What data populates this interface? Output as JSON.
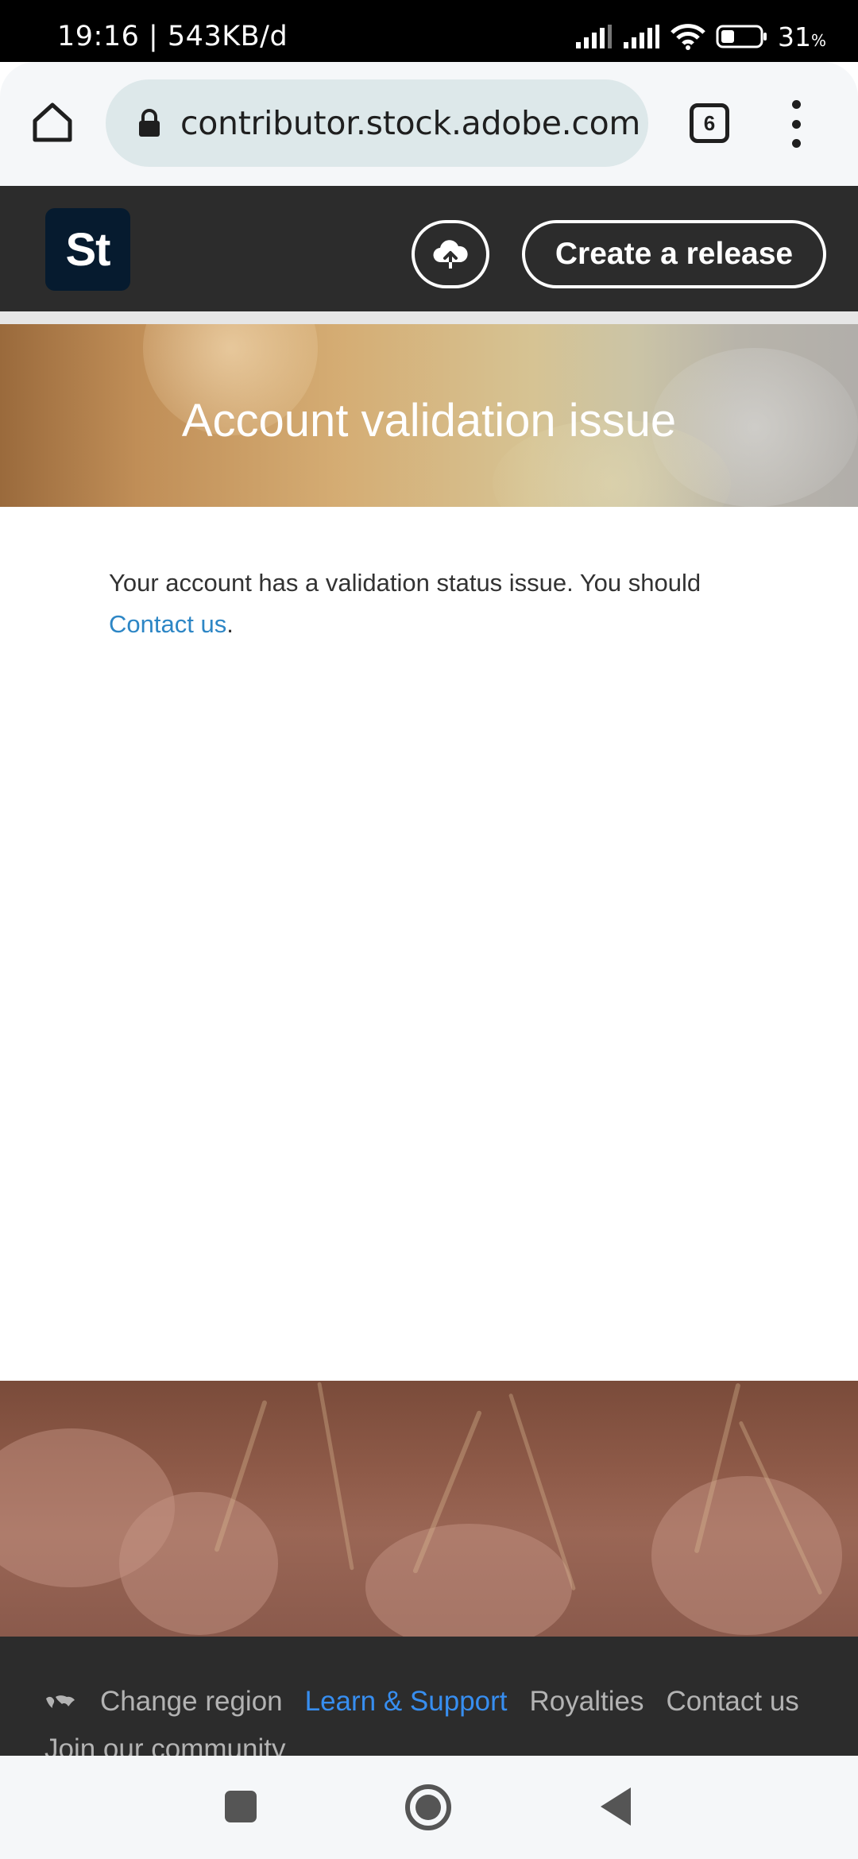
{
  "status_bar": {
    "time_speed": "19:16 | 543KB/d",
    "battery": "31",
    "battery_unit": "%"
  },
  "browser": {
    "url": "contributor.stock.adobe.com",
    "tab_count": "6"
  },
  "site_header": {
    "logo_text": "St",
    "create_release_label": "Create a release"
  },
  "hero": {
    "title": "Account validation issue"
  },
  "content": {
    "message": "Your account has a validation status issue. You should ",
    "contact_link": "Contact us",
    "trailing": "."
  },
  "footer": {
    "change_region": "Change region",
    "learn_support": "Learn & Support",
    "royalties": "Royalties",
    "contact_us": "Contact us",
    "join_community": "Join our community"
  },
  "colors": {
    "link": "#2d86c5",
    "footer_active": "#378ef0",
    "header_bg": "#2c2c2c",
    "logo_bg": "#061b2f"
  }
}
